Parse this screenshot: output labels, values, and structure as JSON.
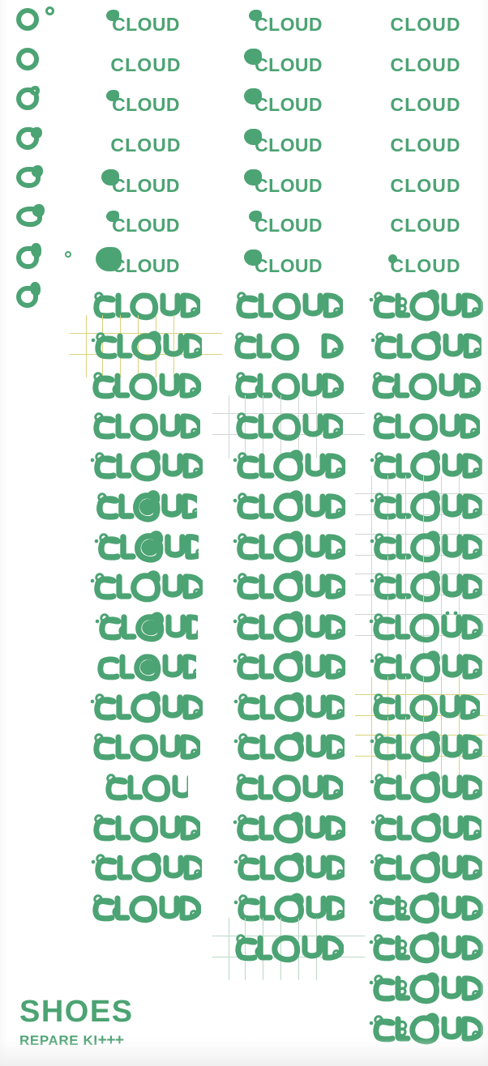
{
  "meta": {
    "word": "CLOUD",
    "accent_color": "#4CA373",
    "background_color": "#ffffff",
    "guide_color_green": "#bcd8c6",
    "guide_color_yellow": "#d9d37a",
    "guide_color_grey": "#cfd6d2"
  },
  "left_strip": {
    "label": "o-morph-sequence",
    "count": 8,
    "tiny_circles": 2
  },
  "columns": [
    {
      "id": "column-1",
      "rows": [
        {
          "text": "CLOUD",
          "stage": "b",
          "blob": "small",
          "guides": null
        },
        {
          "text": "CLOUD",
          "stage": "a",
          "blob": null,
          "guides": null
        },
        {
          "text": "CLOUD",
          "stage": "b",
          "blob": "small",
          "guides": null
        },
        {
          "text": "CLOUD",
          "stage": "a",
          "blob": null,
          "guides": null
        },
        {
          "text": "CLOUD",
          "stage": "b",
          "blob": "medium",
          "guides": null
        },
        {
          "text": "CLOUD",
          "stage": "b",
          "blob": "small",
          "guides": null
        },
        {
          "text": "CLOUD",
          "stage": "b",
          "blob": "large",
          "guides": null
        },
        {
          "text": "CLOUD",
          "stage": "c",
          "variant": 1,
          "guides": null
        },
        {
          "text": "CLOUD",
          "stage": "c",
          "variant": 2,
          "guides": "yellow"
        },
        {
          "text": "CLOUD",
          "stage": "c",
          "variant": 3,
          "guides": null
        },
        {
          "text": "CLOUD",
          "stage": "c",
          "variant": 1,
          "guides": null
        },
        {
          "text": "CLOUD",
          "stage": "c",
          "variant": 4,
          "guides": null
        },
        {
          "text": "CLOUD",
          "stage": "c",
          "variant": 5,
          "guides": null
        },
        {
          "text": "CLOUD",
          "stage": "c",
          "variant": 6,
          "guides": null
        },
        {
          "text": "CLOUD",
          "stage": "c",
          "variant": 4,
          "guides": null
        },
        {
          "text": "CLOUD",
          "stage": "c",
          "variant": 7,
          "guides": null
        },
        {
          "text": "CLOUD",
          "stage": "c",
          "variant": 8,
          "guides": null
        },
        {
          "text": "CLOUD",
          "stage": "c",
          "variant": 4,
          "guides": null
        },
        {
          "text": "CLOUD",
          "stage": "c",
          "variant": 1,
          "guides": null
        },
        {
          "text": "CLOU",
          "stage": "c",
          "variant": 9,
          "guides": null
        },
        {
          "text": "CLOUD",
          "stage": "c",
          "variant": 1,
          "guides": null
        },
        {
          "text": "CLOUD",
          "stage": "c",
          "variant": 2,
          "guides": null
        },
        {
          "text": "CLOUD",
          "stage": "c",
          "variant": 3,
          "guides": null
        }
      ]
    },
    {
      "id": "column-2",
      "rows": [
        {
          "text": "CLOUD",
          "stage": "b",
          "blob": "small",
          "guides": null
        },
        {
          "text": "CLOUD",
          "stage": "b",
          "blob": "medium",
          "guides": null
        },
        {
          "text": "CLOUD",
          "stage": "b",
          "blob": "medium",
          "guides": null
        },
        {
          "text": "CLOUD",
          "stage": "b",
          "blob": "medium",
          "guides": null
        },
        {
          "text": "CLOUD",
          "stage": "b",
          "blob": "medium",
          "guides": null
        },
        {
          "text": "CLOUD",
          "stage": "b",
          "blob": "small",
          "guides": null
        },
        {
          "text": "CLOUD",
          "stage": "b",
          "blob": "medium",
          "guides": null
        },
        {
          "text": "CLOUD",
          "stage": "c",
          "variant": 1,
          "guides": null
        },
        {
          "text": "CLO D",
          "stage": "c",
          "variant": 10,
          "guides": null
        },
        {
          "text": "CLOUD",
          "stage": "c",
          "variant": 3,
          "guides": null
        },
        {
          "text": "CLOUD",
          "stage": "c",
          "variant": 1,
          "guides": "grey"
        },
        {
          "text": "CLOUD",
          "stage": "c",
          "variant": 4,
          "guides": null
        },
        {
          "text": "CLOUD",
          "stage": "c",
          "variant": 4,
          "guides": null
        },
        {
          "text": "CLOUD",
          "stage": "c",
          "variant": 4,
          "guides": null
        },
        {
          "text": "CLOUD",
          "stage": "c",
          "variant": 4,
          "guides": null
        },
        {
          "text": "CLOUD",
          "stage": "c",
          "variant": 4,
          "guides": null
        },
        {
          "text": "CLOUD",
          "stage": "c",
          "variant": 4,
          "guides": null
        },
        {
          "text": "CLOUD",
          "stage": "c",
          "variant": 2,
          "guides": null
        },
        {
          "text": "CLOUD",
          "stage": "c",
          "variant": 2,
          "guides": null
        },
        {
          "text": "CLOUD",
          "stage": "c",
          "variant": 1,
          "guides": null
        },
        {
          "text": "CLOUD",
          "stage": "c",
          "variant": 4,
          "guides": null
        },
        {
          "text": "CLOUD",
          "stage": "c",
          "variant": 2,
          "guides": null
        },
        {
          "text": "CLOUD",
          "stage": "c",
          "variant": 2,
          "guides": null
        },
        {
          "text": "CLOUD",
          "stage": "c",
          "variant": 3,
          "guides": "green"
        }
      ]
    },
    {
      "id": "column-3",
      "rows": [
        {
          "text": "CLOUD",
          "stage": "a",
          "blob": null,
          "guides": null
        },
        {
          "text": "CLOUD",
          "stage": "a",
          "blob": null,
          "guides": null
        },
        {
          "text": "CLOUD",
          "stage": "a",
          "blob": null,
          "guides": null
        },
        {
          "text": "CLOUD",
          "stage": "a",
          "blob": null,
          "guides": null
        },
        {
          "text": "CLOUD",
          "stage": "a",
          "blob": null,
          "guides": null
        },
        {
          "text": "CLOUD",
          "stage": "a",
          "blob": null,
          "guides": null
        },
        {
          "text": "CLOUD",
          "stage": "a",
          "blob": "tiny",
          "guides": null
        },
        {
          "text": "CLOUD",
          "stage": "c",
          "variant": 11,
          "guides": null
        },
        {
          "text": "CLOUD",
          "stage": "c",
          "variant": 2,
          "guides": null
        },
        {
          "text": "CLOUD",
          "stage": "c",
          "variant": 3,
          "guides": null
        },
        {
          "text": "CLOUD",
          "stage": "c",
          "variant": 1,
          "guides": null
        },
        {
          "text": "CLOUD",
          "stage": "c",
          "variant": 4,
          "guides": null
        },
        {
          "text": "CLOUD",
          "stage": "c",
          "variant": 4,
          "guides": "grey"
        },
        {
          "text": "CLOUD",
          "stage": "c",
          "variant": 4,
          "guides": "grey"
        },
        {
          "text": "CLOUD",
          "stage": "c",
          "variant": 4,
          "guides": "grey"
        },
        {
          "text": "CLOUD",
          "stage": "c",
          "variant": 12,
          "guides": "grey"
        },
        {
          "text": "CLOUD",
          "stage": "c",
          "variant": 4,
          "guides": null
        },
        {
          "text": "CLOUD",
          "stage": "c",
          "variant": 1,
          "guides": "yellow"
        },
        {
          "text": "CLOUD",
          "stage": "c",
          "variant": 4,
          "guides": "yellow"
        },
        {
          "text": "CLOUD",
          "stage": "c",
          "variant": 4,
          "guides": null
        },
        {
          "text": "CLOUD",
          "stage": "c",
          "variant": 2,
          "guides": null
        },
        {
          "text": "CLOUD",
          "stage": "c",
          "variant": 4,
          "guides": null
        },
        {
          "text": "CLOUD",
          "stage": "c",
          "variant": 11,
          "guides": null
        },
        {
          "text": "CLOUD",
          "stage": "c",
          "variant": 11,
          "guides": null
        },
        {
          "text": "CLOUD",
          "stage": "c",
          "variant": 11,
          "guides": null
        },
        {
          "text": "CLOUD",
          "stage": "c",
          "variant": 11,
          "guides": null
        }
      ]
    }
  ],
  "footer": {
    "brand": "SHOES",
    "tagline_text": "REPARE KI",
    "tagline_plus": "+++"
  }
}
